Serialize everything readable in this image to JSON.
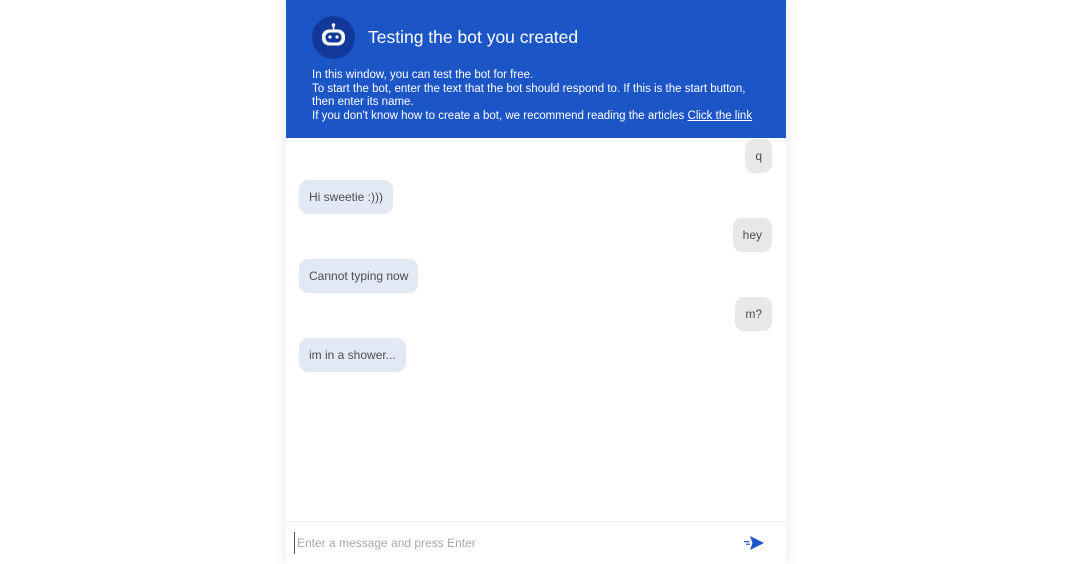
{
  "header": {
    "title": "Testing the bot you created",
    "avatar_icon": "robot-icon",
    "description_lines": [
      "In this window, you can test the bot for free.",
      "To start the bot, enter the text that the bot should respond to. If this is the start button,",
      "then enter its name.",
      "If you don't know how to create a bot, we recommend reading the articles"
    ],
    "link_text": "Click the link"
  },
  "messages": [
    {
      "from": "user",
      "text": "q"
    },
    {
      "from": "bot",
      "text": "Hi sweetie :)))"
    },
    {
      "from": "user",
      "text": "hey"
    },
    {
      "from": "bot",
      "text": "Cannot typing now"
    },
    {
      "from": "user",
      "text": "m?"
    },
    {
      "from": "bot",
      "text": "im in a shower..."
    }
  ],
  "composer": {
    "placeholder": "Enter a message and press Enter",
    "value": "",
    "send_icon": "send-icon"
  },
  "colors": {
    "header_bg": "#1b55c6",
    "avatar_bg": "#12399a",
    "user_bubble": "#e8e8e8",
    "bot_bubble": "#e2e8f4",
    "send_icon": "#1b55c6"
  }
}
